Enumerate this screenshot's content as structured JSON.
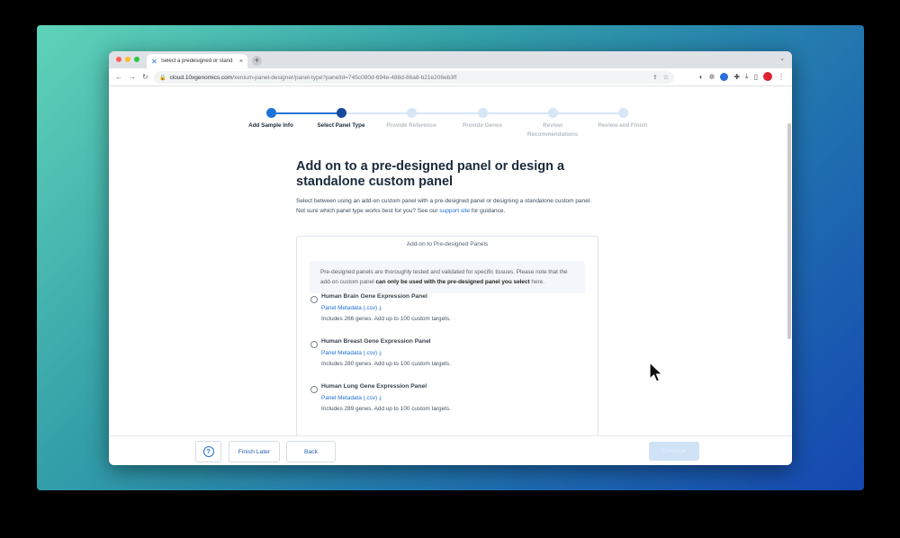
{
  "browser": {
    "tab_title": "Select a predesigned or stand",
    "tab_close": "×",
    "new_tab": "+",
    "url_host": "cloud.10xgenomics.com",
    "url_path": "/xenium-panel-designer/panel-type?panelId=745c080d-694e-488d-86a8-b21e208eb3ff"
  },
  "stepper": {
    "steps": [
      {
        "label": "Add Sample Info",
        "state": "done"
      },
      {
        "label": "Select Panel Type",
        "state": "current"
      },
      {
        "label": "Provide Reference",
        "state": "todo"
      },
      {
        "label": "Provide Genes",
        "state": "todo"
      },
      {
        "label": "Review Recommendations",
        "state": "todo"
      },
      {
        "label": "Review and Finish",
        "state": "todo"
      }
    ]
  },
  "main": {
    "title": "Add on to a pre-designed panel or design a standalone custom panel",
    "description_before": "Select between using an add-on custom panel with a pre-designed panel or designing a standalone custom panel. Not sure which panel type works best for you? See our ",
    "description_link": "support site",
    "description_after": " for guidance."
  },
  "card": {
    "title": "Add-on to Pre-designed Panels",
    "info_before": "Pre-designed panels are thoroughly tested and validated for specific tissues. Please note that the add-on custom panel ",
    "info_bold": "can only be used with the pre-designed panel you select",
    "info_after": " here.",
    "options": [
      {
        "name": "Human Brain Gene Expression Panel",
        "link": "Panel Metadata (.csv)",
        "sub": "Includes 266 genes. Add up to 100 custom targets."
      },
      {
        "name": "Human Breast Gene Expression Panel",
        "link": "Panel Metadata (.csv)",
        "sub": "Includes 280 genes. Add up to 100 custom targets."
      },
      {
        "name": "Human Lung Gene Expression Panel",
        "link": "Panel Metadata (.csv)",
        "sub": "Includes 289 genes. Add up to 100 custom targets."
      }
    ]
  },
  "footer": {
    "help": "?",
    "finish_later": "Finish Later",
    "back": "Back",
    "continue": "Continue"
  },
  "colors": {
    "accent": "#1f6fd6",
    "step_done": "#1a73d9",
    "step_current": "#174a9b",
    "step_todo": "#d6e6f7",
    "label_todo": "#b5bcc4"
  }
}
